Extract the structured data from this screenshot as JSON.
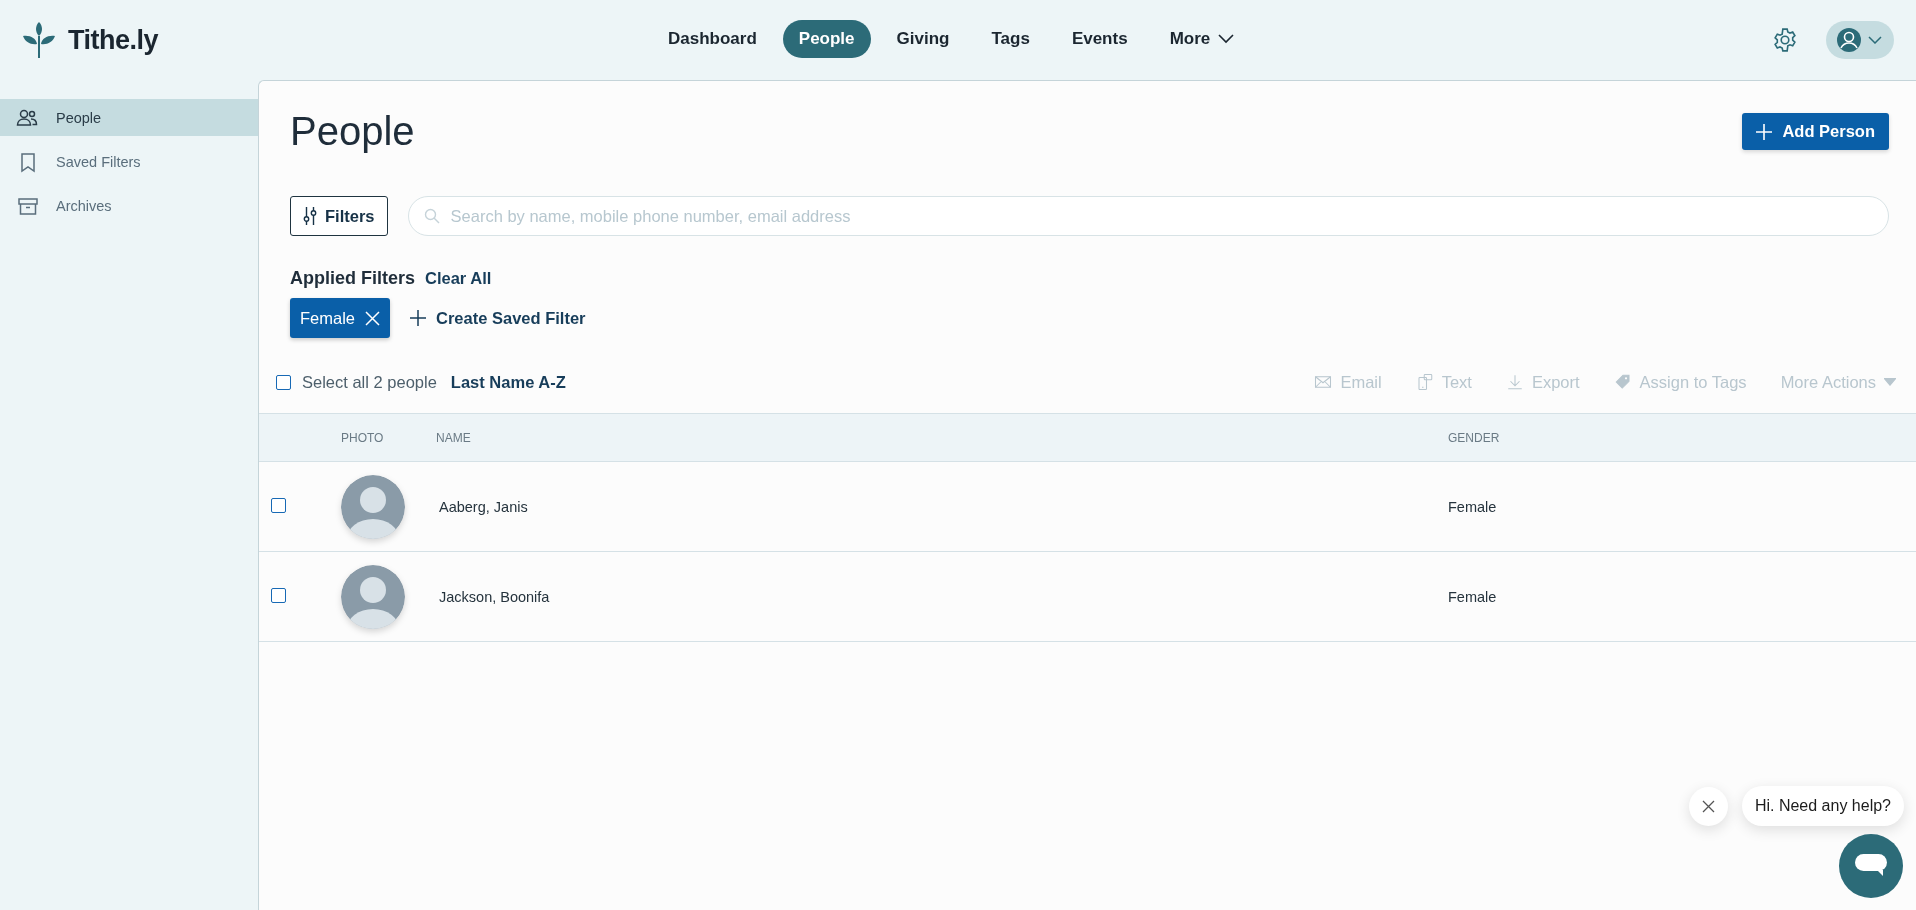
{
  "brand": "Tithe.ly",
  "nav": [
    {
      "label": "Dashboard",
      "selected": false
    },
    {
      "label": "People",
      "selected": true
    },
    {
      "label": "Giving",
      "selected": false
    },
    {
      "label": "Tags",
      "selected": false
    },
    {
      "label": "Events",
      "selected": false
    },
    {
      "label": "More",
      "selected": false
    }
  ],
  "sidebar": {
    "items": [
      {
        "label": "People",
        "selected": true
      },
      {
        "label": "Saved Filters",
        "selected": false
      },
      {
        "label": "Archives",
        "selected": false
      }
    ]
  },
  "page_title": "People",
  "add_button": "Add Person",
  "filters_button": "Filters",
  "search": {
    "placeholder": "Search by name, mobile phone number, email address"
  },
  "applied_filters": {
    "label": "Applied Filters",
    "clear_all": "Clear All",
    "chips": [
      {
        "label": "Female"
      }
    ],
    "create_saved_filter": "Create Saved Filter"
  },
  "select_all": {
    "label": "Select all 2 people",
    "checked": false
  },
  "sort": "Last Name A-Z",
  "actions": [
    {
      "label": "Email",
      "disabled": true
    },
    {
      "label": "Text",
      "disabled": true
    },
    {
      "label": "Export",
      "disabled": true
    },
    {
      "label": "Assign to Tags",
      "disabled": true
    },
    {
      "label": "More Actions",
      "disabled": true
    }
  ],
  "table": {
    "columns": [
      "PHOTO",
      "NAME",
      "GENDER"
    ],
    "rows": [
      {
        "name": "Aaberg, Janis",
        "gender": "Female",
        "checked": false
      },
      {
        "name": "Jackson, Boonifa",
        "gender": "Female",
        "checked": false
      }
    ]
  },
  "chat": {
    "message": "Hi. Need any help?"
  }
}
